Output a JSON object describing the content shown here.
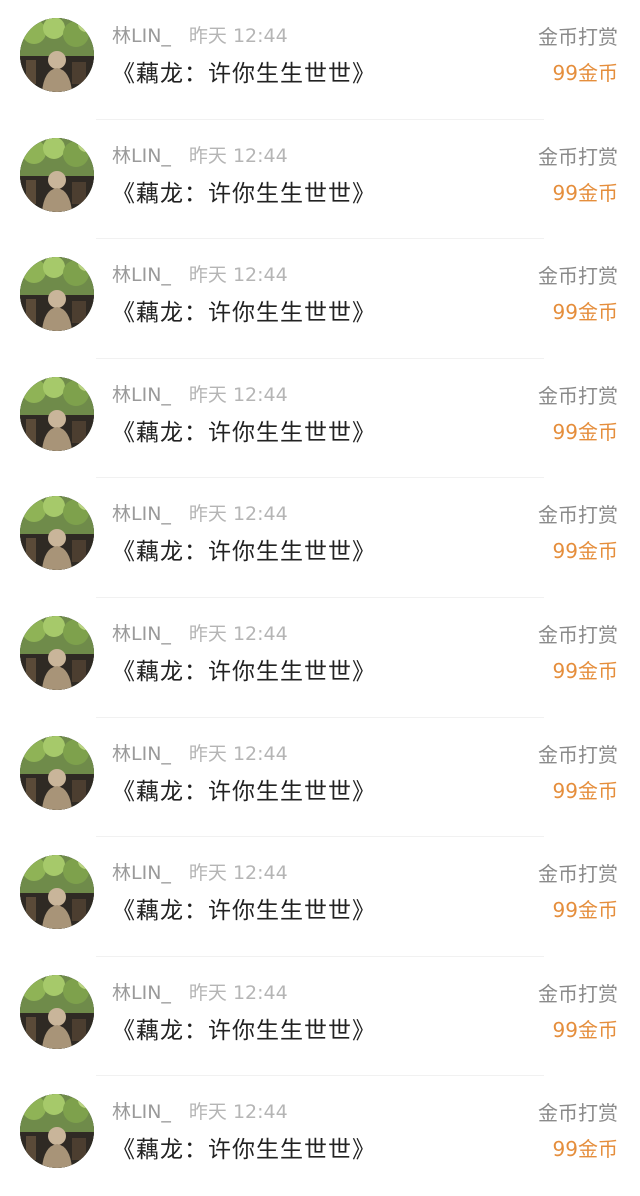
{
  "records": [
    {
      "user": "林LIN_",
      "time": "昨天 12:44",
      "book": "《藕龙：许你生生世世》",
      "reward_type": "金币打赏",
      "amount": "99金币",
      "avatar_icon": "avatar-photo-icon"
    },
    {
      "user": "林LIN_",
      "time": "昨天 12:44",
      "book": "《藕龙：许你生生世世》",
      "reward_type": "金币打赏",
      "amount": "99金币",
      "avatar_icon": "avatar-photo-icon"
    },
    {
      "user": "林LIN_",
      "time": "昨天 12:44",
      "book": "《藕龙：许你生生世世》",
      "reward_type": "金币打赏",
      "amount": "99金币",
      "avatar_icon": "avatar-photo-icon"
    },
    {
      "user": "林LIN_",
      "time": "昨天 12:44",
      "book": "《藕龙：许你生生世世》",
      "reward_type": "金币打赏",
      "amount": "99金币",
      "avatar_icon": "avatar-photo-icon"
    },
    {
      "user": "林LIN_",
      "time": "昨天 12:44",
      "book": "《藕龙：许你生生世世》",
      "reward_type": "金币打赏",
      "amount": "99金币",
      "avatar_icon": "avatar-photo-icon"
    },
    {
      "user": "林LIN_",
      "time": "昨天 12:44",
      "book": "《藕龙：许你生生世世》",
      "reward_type": "金币打赏",
      "amount": "99金币",
      "avatar_icon": "avatar-photo-icon"
    },
    {
      "user": "林LIN_",
      "time": "昨天 12:44",
      "book": "《藕龙：许你生生世世》",
      "reward_type": "金币打赏",
      "amount": "99金币",
      "avatar_icon": "avatar-photo-icon"
    },
    {
      "user": "林LIN_",
      "time": "昨天 12:44",
      "book": "《藕龙：许你生生世世》",
      "reward_type": "金币打赏",
      "amount": "99金币",
      "avatar_icon": "avatar-photo-icon"
    },
    {
      "user": "林LIN_",
      "time": "昨天 12:44",
      "book": "《藕龙：许你生生世世》",
      "reward_type": "金币打赏",
      "amount": "99金币",
      "avatar_icon": "avatar-photo-icon"
    },
    {
      "user": "林LIN_",
      "time": "昨天 12:44",
      "book": "《藕龙：许你生生世世》",
      "reward_type": "金币打赏",
      "amount": "99金币",
      "avatar_icon": "avatar-photo-icon"
    }
  ],
  "colors": {
    "amount": "#e58e3c",
    "reward_type": "#8a8a8a",
    "meta": "#9a9a9a",
    "title": "#222222",
    "divider": "#f1f1f1"
  }
}
